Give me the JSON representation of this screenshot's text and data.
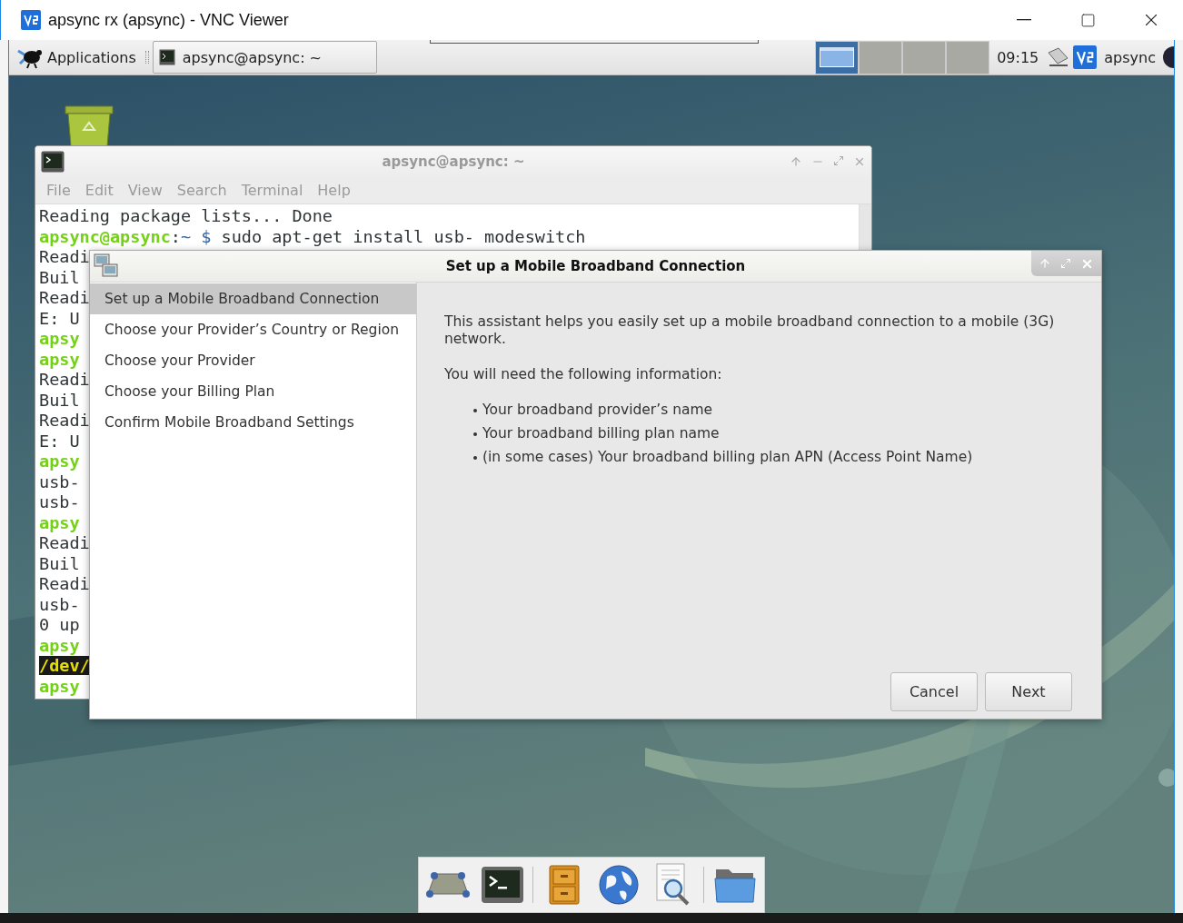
{
  "vnc_window": {
    "title": "apsync rx (apsync) - VNC Viewer"
  },
  "panel": {
    "applications_label": "Applications",
    "task": {
      "label": "apsync@apsync: ~"
    },
    "workspaces": [
      {
        "selected": true
      },
      {
        "selected": false
      },
      {
        "selected": false
      },
      {
        "selected": false
      }
    ],
    "clock": "09:15",
    "user": "apsync"
  },
  "terminal": {
    "title": "apsync@apsync: ~",
    "menu": [
      "File",
      "Edit",
      "View",
      "Search",
      "Terminal",
      "Help"
    ],
    "lines": [
      {
        "kind": "output",
        "text": "Reading package lists... Done"
      },
      {
        "kind": "command",
        "user": "apsync@apsync",
        "separator": ":",
        "path": "~",
        "prompt": "$",
        "text": "sudo apt-get install usb- modeswitch"
      },
      {
        "kind": "output",
        "text": "Readi"
      },
      {
        "kind": "output",
        "text": "Buil"
      },
      {
        "kind": "output",
        "text": "Readi"
      },
      {
        "kind": "output",
        "text": "E: U"
      },
      {
        "kind": "prompt",
        "text": "apsy"
      },
      {
        "kind": "prompt",
        "text": "apsy"
      },
      {
        "kind": "output",
        "text": "Readi"
      },
      {
        "kind": "output",
        "text": "Buil"
      },
      {
        "kind": "output",
        "text": "Readi"
      },
      {
        "kind": "output",
        "text": "E: U"
      },
      {
        "kind": "prompt",
        "text": "apsy"
      },
      {
        "kind": "output",
        "text": "usb-"
      },
      {
        "kind": "output",
        "text": "usb-"
      },
      {
        "kind": "prompt",
        "text": "apsy"
      },
      {
        "kind": "output",
        "text": "Readi"
      },
      {
        "kind": "output",
        "text": "Buil"
      },
      {
        "kind": "output",
        "text": "Readi"
      },
      {
        "kind": "output",
        "text": "usb-"
      },
      {
        "kind": "output",
        "text": "0 up"
      },
      {
        "kind": "prompt",
        "text": "apsy"
      },
      {
        "kind": "highlight",
        "text": "/dev/"
      },
      {
        "kind": "prompt",
        "text": "apsy"
      }
    ]
  },
  "dialog": {
    "title": "Set up a Mobile Broadband Connection",
    "steps": [
      {
        "label": "Set up a Mobile Broadband Connection",
        "selected": true
      },
      {
        "label": "Choose your Provider’s Country or Region",
        "selected": false
      },
      {
        "label": "Choose your Provider",
        "selected": false
      },
      {
        "label": "Choose your Billing Plan",
        "selected": false
      },
      {
        "label": "Confirm Mobile Broadband Settings",
        "selected": false
      }
    ],
    "intro": "This assistant helps you easily set up a mobile broadband connection to a mobile (3G) network.",
    "need_label": "You will need the following information:",
    "items": [
      "Your broadband provider’s name",
      "Your broadband billing plan name",
      "(in some cases) Your broadband billing plan APN (Access Point Name)"
    ],
    "buttons": [
      {
        "label": "Cancel"
      },
      {
        "label": "Next"
      }
    ]
  },
  "dock": {
    "items": [
      {
        "kind": "drive"
      },
      {
        "kind": "terminal"
      },
      {
        "kind": "separator"
      },
      {
        "kind": "cabinet"
      },
      {
        "kind": "globe"
      },
      {
        "kind": "search"
      },
      {
        "kind": "separator"
      },
      {
        "kind": "folder"
      }
    ]
  }
}
